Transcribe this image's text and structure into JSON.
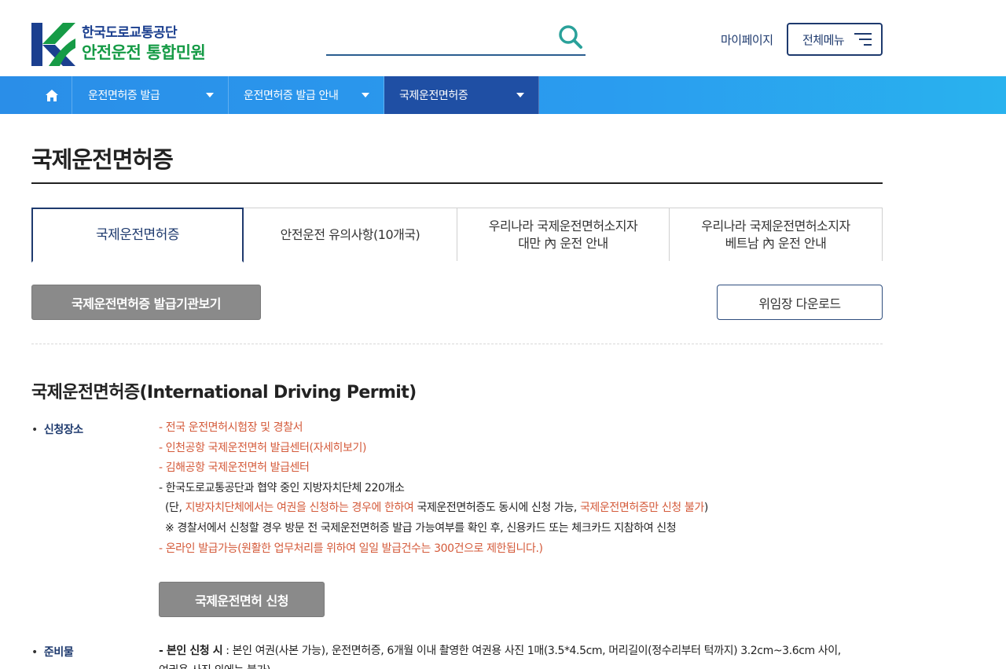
{
  "header": {
    "org_name": "한국도로교통공단",
    "site_title": "안전운전 통합민원",
    "search_placeholder": "",
    "mypage_label": "마이페이지",
    "allmenu_label": "전체메뉴"
  },
  "nav": {
    "items": [
      {
        "label": "운전면허증 발급"
      },
      {
        "label": "운전면허증 발급 안내"
      },
      {
        "label": "국제운전면허증"
      }
    ]
  },
  "page": {
    "title": "국제운전면허증"
  },
  "tabs": [
    {
      "label": "국제운전면허증"
    },
    {
      "label": "안전운전 유의사항(10개국)"
    },
    {
      "label": "우리나라 국제운전면허소지자\n대만 內 운전 안내"
    },
    {
      "label": "우리나라 국제운전면허소지자\n베트남 內 운전 안내"
    }
  ],
  "buttons": {
    "agency_view": "국제운전면허증 발급기관보기",
    "proxy_download": "위임장 다운로드",
    "apply": "국제운전면허 신청"
  },
  "section": {
    "title": "국제운전면허증(International Driving Permit)",
    "apply_place_label": "신청장소",
    "lines": {
      "l1": "- 전국 운전면허시험장 및 경찰서",
      "l2": "- 인천공항 국제운전면허 발급센터(자세히보기)",
      "l3": "- 김해공항 국제운전면허 발급센터",
      "l4": "- 한국도로교통공단과 협약 중인 지방자치단체 220개소",
      "l5a": "(단, ",
      "l5b": "지방자치단체에서는 여권을 신청하는 경우에 한하여",
      "l5c": " 국제운전면허증도 동시에 신청 가능, ",
      "l5d": "국제운전면허증만 신청 불가",
      "l5e": ")",
      "l6": "※ 경찰서에서 신청할 경우 방문 전 국제운전면허증 발급 가능여부를 확인 후, 신용카드 또는 체크카드 지참하여 신청",
      "l7": "- 온라인 발급가능(원활한 업무처리를 위하여 일일 발급건수는 300건으로 제한됩니다.)"
    },
    "prep_label": "준비물",
    "prep_bold": "- 본인 신청 시",
    "prep_text": " : 본인 여권(사본 가능), 운전면허증, 6개월 이내 촬영한 여권용 사진 1매(3.5*4.5cm, 머리길이(정수리부터 턱까지) 3.2cm~3.6cm 사이,",
    "prep_text2": "여권용 사진 외에는 불가)"
  },
  "colors": {
    "brand_navy": "#1e3a6e",
    "brand_green": "#169b46",
    "nav_blue": "#2a9cef",
    "nav_active": "#1f4fa4",
    "notice_red": "#d45a3a"
  }
}
